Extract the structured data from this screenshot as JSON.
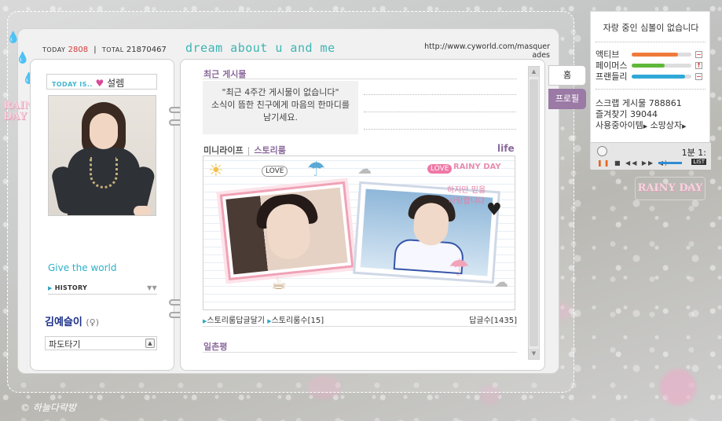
{
  "header": {
    "today_label": "TODAY",
    "today_value": "2808",
    "total_label": "TOTAL",
    "total_value": "21870467",
    "title": "dream about u and me",
    "url": "http://www.cyworld.com/masquerades"
  },
  "profile": {
    "today_is_label": "TODAY IS..",
    "mood": "설렘",
    "tagline": "Give the world",
    "history_label": "HISTORY",
    "name": "김예슬이",
    "gender_symbol": "(♀)",
    "select_value": "파도타기"
  },
  "main": {
    "recent_title": "최근 게시물",
    "notice_lines": [
      "\"최근 4주간 게시물이 없습니다\"",
      "소식이 뜸한 친구에게 마음의 한마디를",
      "남기세요."
    ],
    "tab_miniroom": "미니라이프",
    "tab_storyroom": "스토리룸",
    "life_label": "life",
    "story_reply": "스토리룸답글달기",
    "story_count_label": "스토리룸수",
    "story_count": "[15]",
    "reply_count_label": "답글수",
    "reply_count": "[1435]",
    "ilchon_title": "일촌평",
    "miniroom_stickers": [
      "LOVE",
      "LOVE",
      "RAINY DAY",
      "하지만 믿을",
      "사랑합니다"
    ]
  },
  "side_tabs": {
    "home": "홈",
    "profile": "프로필"
  },
  "widget": {
    "status": "자랑 중인 심볼이 없습니다",
    "stats": [
      {
        "label": "액티브",
        "value": 0.78,
        "color": "#f07a3b"
      },
      {
        "label": "페이머스",
        "value": 0.55,
        "color": "#5fb83a"
      },
      {
        "label": "프랜들리",
        "value": 0.9,
        "color": "#2fa9d6"
      }
    ],
    "scrap_label": "스크랩 게시물",
    "scrap_value": "788861",
    "fav_label": "즐겨찾기",
    "fav_value": "39044",
    "item_label": "사용중아이템",
    "wish_label": "소망상자",
    "player_time": "1분 1:",
    "player_list": "LIST"
  },
  "decor": {
    "rainy_left": "RAINY DAY",
    "rainy_right": "RAINY DAY",
    "signature": "하늘다락방",
    "copyright_symbol": "©"
  }
}
